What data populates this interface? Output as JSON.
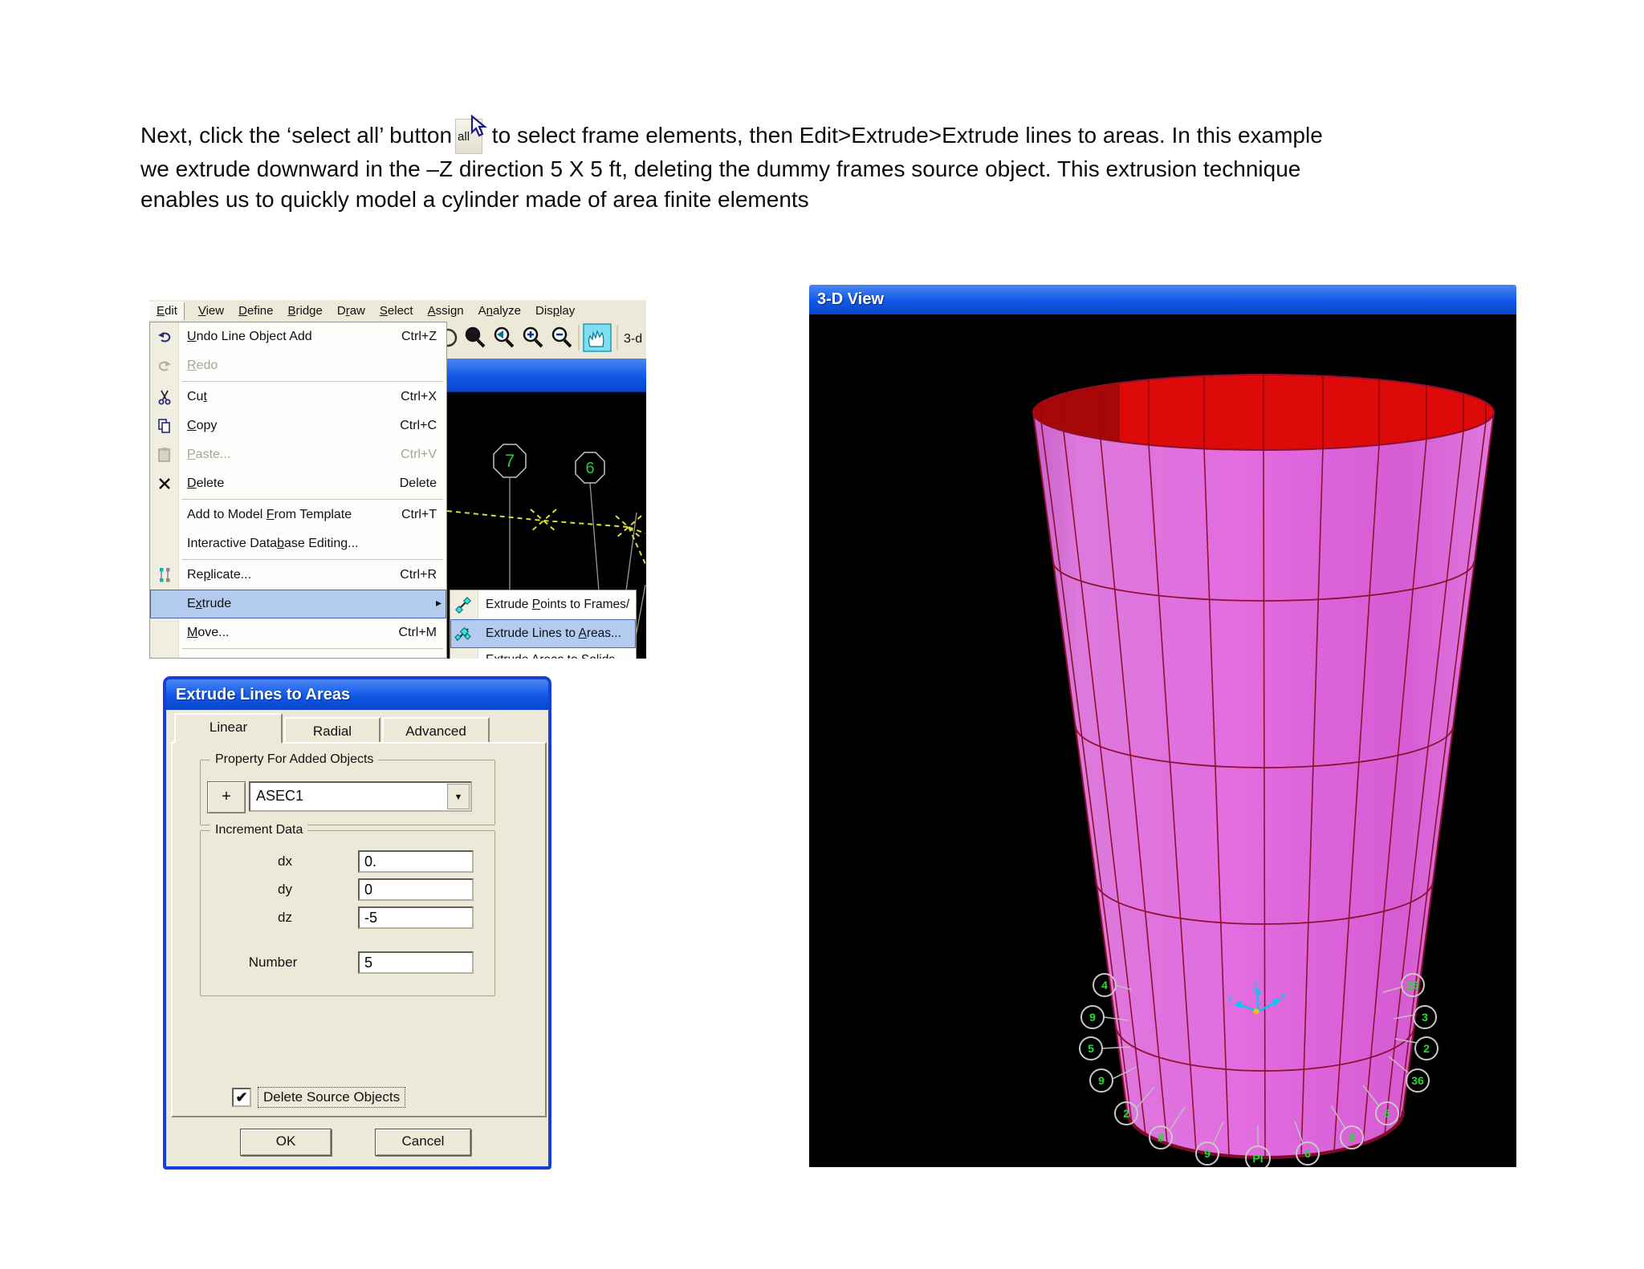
{
  "paragraph": {
    "line1_before": "Next, click the ‘select all’ button",
    "all_button": "all",
    "line1_after": " to select frame elements, then Edit>Extrude>Extrude lines to areas. In this example",
    "line2": "we extrude downward in the –Z direction 5 X 5 ft, deleting the dummy frames source object. This extrusion technique",
    "line3": "enables us to quickly model a cylinder made of area finite elements"
  },
  "sap": {
    "menubar": [
      {
        "label": "Edit"
      },
      {
        "label": "View"
      },
      {
        "label": "Define"
      },
      {
        "label": "Bridge"
      },
      {
        "label": "Draw"
      },
      {
        "label": "Select"
      },
      {
        "label": "Assign"
      },
      {
        "label": "Analyze"
      },
      {
        "label": "Display"
      }
    ],
    "edit_menu": {
      "items": [
        {
          "label": "Undo Line Object Add",
          "shortcut": "Ctrl+Z"
        },
        {
          "label": "Redo",
          "disabled": true
        },
        {
          "label": "Cut",
          "shortcut": "Ctrl+X"
        },
        {
          "label": "Copy",
          "shortcut": "Ctrl+C"
        },
        {
          "label": "Paste...",
          "shortcut": "Ctrl+V",
          "disabled": true
        },
        {
          "label": "Delete",
          "shortcut": "Delete"
        },
        {
          "label": "Add to Model From Template",
          "shortcut": "Ctrl+T"
        },
        {
          "label": "Interactive Database Editing..."
        },
        {
          "label": "Replicate...",
          "shortcut": "Ctrl+R"
        },
        {
          "label": "Extrude",
          "highlighted": true
        },
        {
          "label": "Move...",
          "shortcut": "Ctrl+M"
        }
      ]
    },
    "submenu": {
      "items": [
        {
          "label": "Extrude Points to Frames/"
        },
        {
          "label": "Extrude Lines to Areas...",
          "highlighted": true
        },
        {
          "label": "Extrude Areas to Solids..."
        }
      ]
    },
    "toolbar": {
      "threed_label": "3-d"
    },
    "canvas": {
      "node_labels": [
        "7",
        "6"
      ]
    }
  },
  "dialog": {
    "title": "Extrude Lines to Areas",
    "tabs": [
      {
        "label": "Linear",
        "active": true
      },
      {
        "label": "Radial"
      },
      {
        "label": "Advanced"
      }
    ],
    "property_group": {
      "label": "Property For Added Objects",
      "add_button_label": "+",
      "combo_value": "ASEC1",
      "combo_arrow": "▼"
    },
    "increment_group": {
      "label": "Increment Data",
      "fields": [
        {
          "label": "dx",
          "value": "0."
        },
        {
          "label": "dy",
          "value": "0"
        },
        {
          "label": "dz",
          "value": "-5"
        },
        {
          "label": "Number",
          "value": "5"
        }
      ]
    },
    "delete_source": {
      "label": "Delete Source Objects",
      "checked": true,
      "check_glyph": "✔"
    },
    "buttons": {
      "ok": "OK",
      "cancel": "Cancel"
    }
  },
  "view3d": {
    "title": "3-D View",
    "axis": {
      "x": "X",
      "y": "Y",
      "z": "Z"
    },
    "node_labels": [
      "4",
      "9",
      "5",
      "9",
      "2",
      "8",
      "9",
      "PI",
      "6",
      "8",
      "6",
      "36",
      "2",
      "3",
      "26"
    ]
  },
  "icons": {
    "submenu_arrow": "▸"
  },
  "colors": {
    "xp_titlebar": "#1158E8",
    "menu_highlight": "#B4CBF0",
    "cylinder_pink": "#E26CE0",
    "cylinder_top_red": "#DE0909",
    "mesh_line": "#8E1030",
    "node_label_green": "#22DD33",
    "axis_cyan": "#00CCF2",
    "canvas_black": "#000000",
    "dialog_border_blue": "#1540D8",
    "face_beige": "#ECE9D8"
  }
}
